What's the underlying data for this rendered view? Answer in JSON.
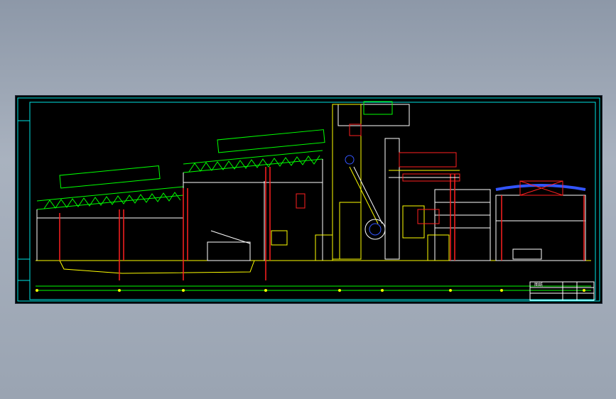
{
  "viewer": {
    "background": "#000000"
  },
  "colors": {
    "frame": "#00e5e5",
    "structure": "#ffffff",
    "truss": "#00ff00",
    "column": "#ff2020",
    "equipment": "#ffff00",
    "ground": "#ffff00",
    "axis": "#00ff00",
    "blue_equipment": "#3355ff",
    "magenta": "#ff00ff"
  },
  "drawing": {
    "title_block_label": "图纸"
  }
}
